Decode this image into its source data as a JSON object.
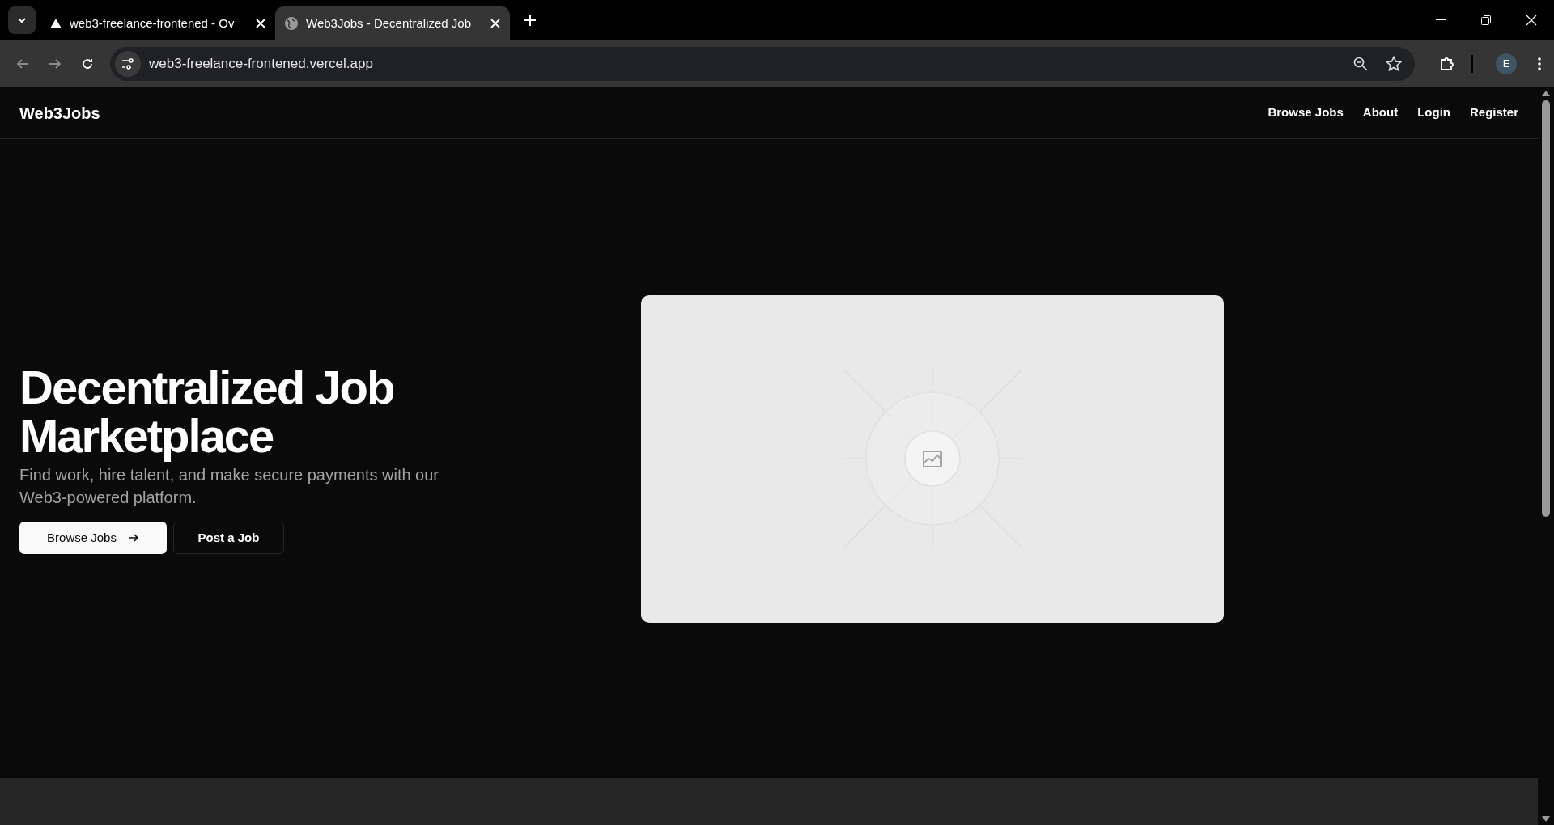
{
  "browser": {
    "tabs": [
      {
        "title": "web3-freelance-frontened - Ov",
        "selected": false,
        "kind": "triangle"
      },
      {
        "title": "Web3Jobs - Decentralized Job",
        "selected": true,
        "kind": "globe"
      }
    ],
    "address": "web3-freelance-frontened.vercel.app",
    "profile_initial": "E"
  },
  "nav": {
    "logo": "Web3Jobs",
    "links": [
      "Browse Jobs",
      "About",
      "Login",
      "Register"
    ]
  },
  "hero": {
    "title": "Decentralized Job Marketplace",
    "subtitle": "Find work, hire talent, and make secure payments with our Web3-powered platform.",
    "buttons": [
      {
        "label": "Browse Jobs",
        "kind": "primary"
      },
      {
        "label": "Post a Job",
        "kind": "outline"
      }
    ]
  }
}
